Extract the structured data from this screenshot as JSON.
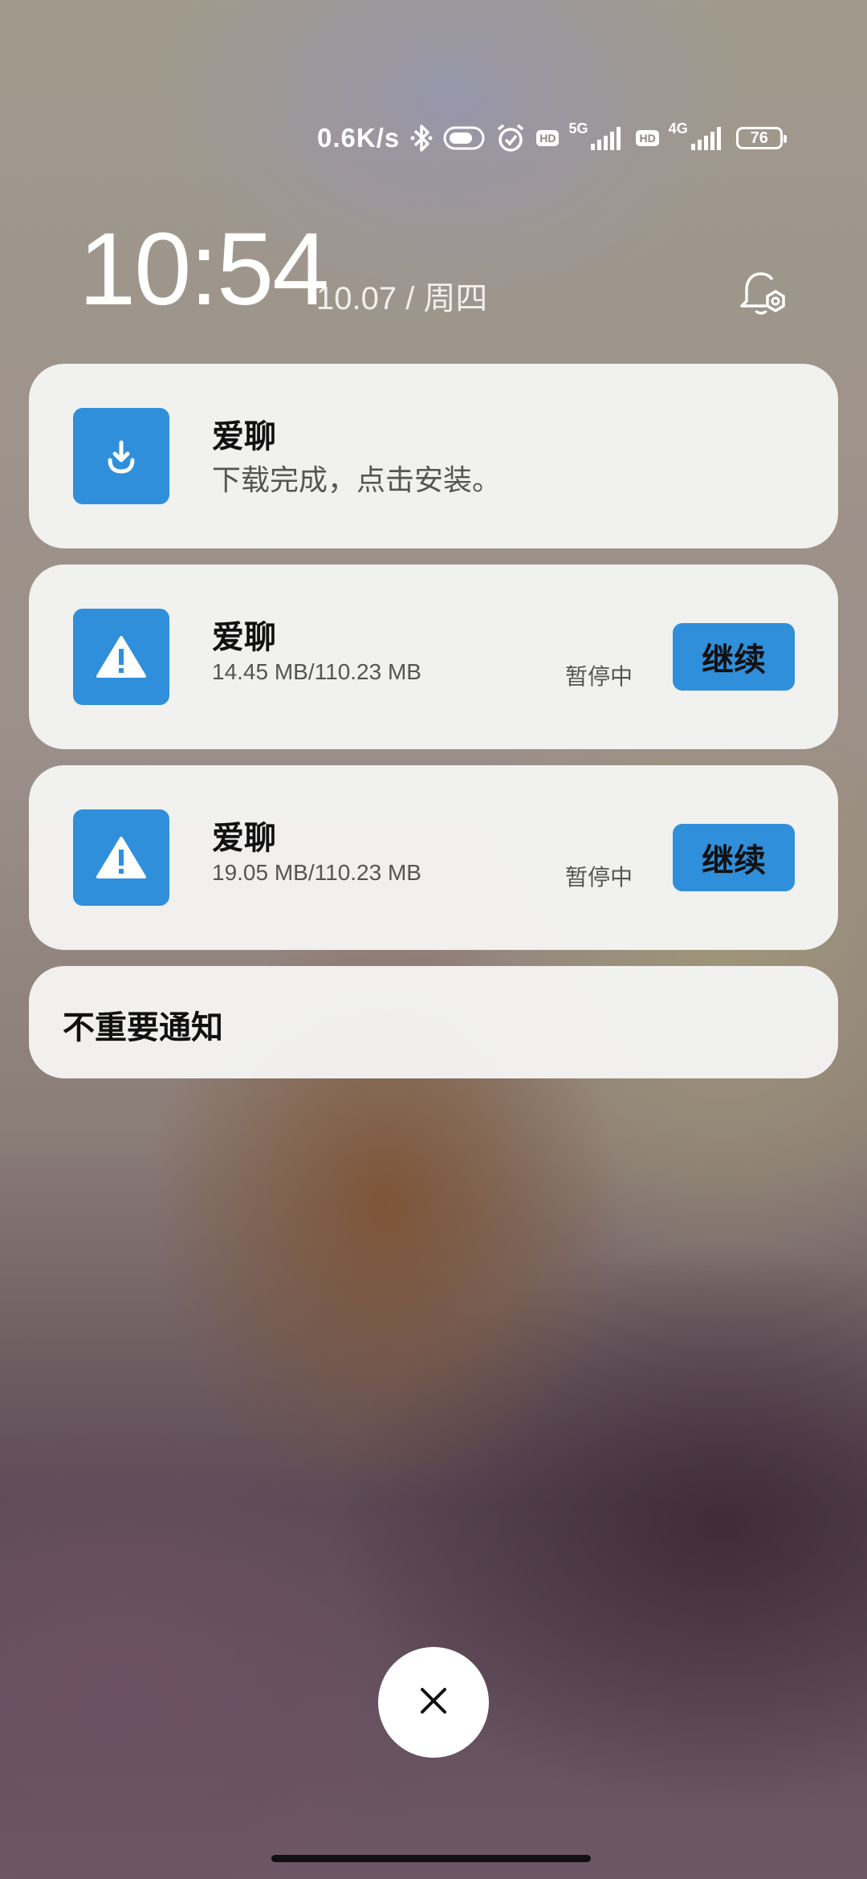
{
  "status_bar": {
    "speed": "0.6K/s",
    "hd1": "HD",
    "net1": "5G",
    "hd2": "HD",
    "net2": "4G",
    "battery": "76"
  },
  "lockscreen": {
    "time": "10:54",
    "date": "10.07 / 周四"
  },
  "notifications": [
    {
      "title": "爱聊",
      "text": "下载完成，点击安装。",
      "icon": "download-icon"
    },
    {
      "title": "爱聊",
      "size": "14.45 MB/110.23 MB",
      "status": "暂停中",
      "button": "继续",
      "icon": "warning-icon"
    },
    {
      "title": "爱聊",
      "size": "19.05 MB/110.23 MB",
      "status": "暂停中",
      "button": "继续",
      "icon": "warning-icon"
    }
  ],
  "minor_notifications": {
    "label": "不重要通知"
  },
  "colors": {
    "accent": "#2f8fdb",
    "card_bg": "#f5f5f4"
  }
}
